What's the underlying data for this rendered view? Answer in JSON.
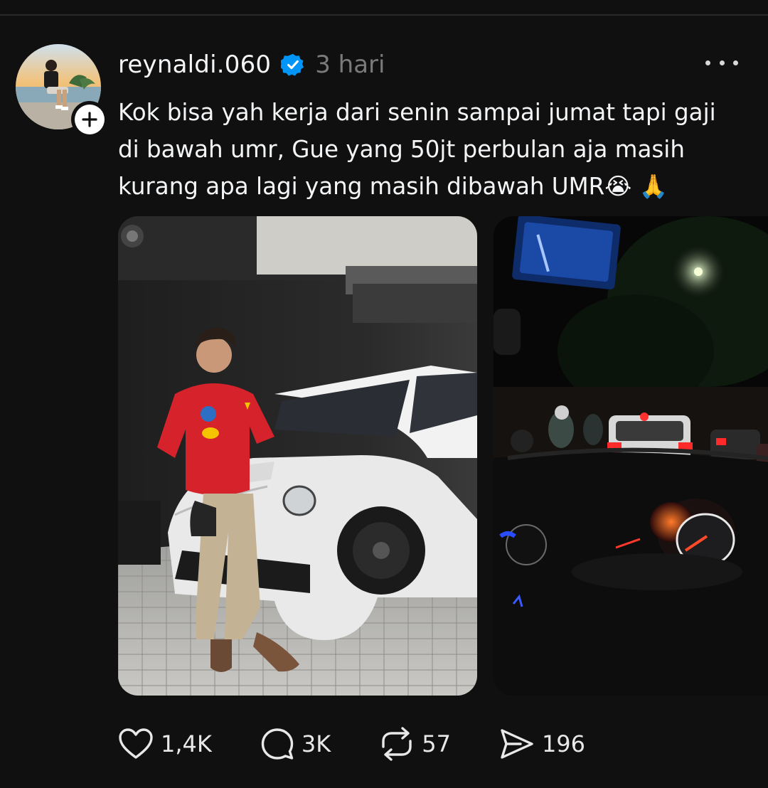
{
  "post": {
    "username": "reynaldi.060",
    "time": "3 hari",
    "text_line1": "Kok bisa yah kerja dari senin sampai jumat tapi gaji",
    "text_line2": "di bawah umr, Gue yang 50jt perbulan aja masih",
    "text_line3": "kurang apa lagi yang masih dibawah UMR",
    "emoji_cry": "😭",
    "emoji_pray": "🙏"
  },
  "icons": {
    "avatar": "avatar",
    "follow": "plus-icon",
    "verified": "verified-badge-icon",
    "more": "more-horizontal-icon",
    "like": "heart-icon",
    "reply": "comment-icon",
    "repost": "repost-icon",
    "share": "send-icon"
  },
  "actions": {
    "likes": "1,4K",
    "replies": "3K",
    "reposts": "57",
    "shares": "196"
  },
  "colors": {
    "background": "#101010",
    "text": "#f3f5f7",
    "muted": "#7a7a7a",
    "verified": "#0095f6"
  }
}
